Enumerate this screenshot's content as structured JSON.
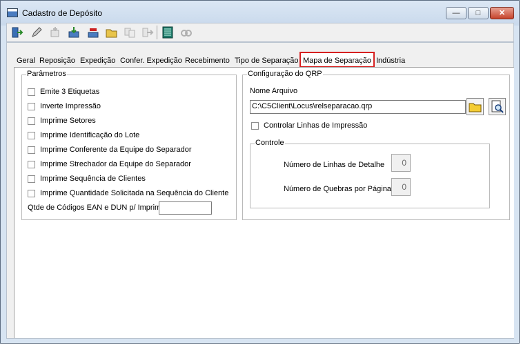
{
  "window": {
    "title": "Cadastro de Depósito"
  },
  "toolbar": {
    "icons": [
      "exit-icon",
      "edit-icon",
      "new-icon",
      "save-icon",
      "delete-icon",
      "open-icon",
      "copy-icon",
      "export-icon",
      "report-icon",
      "search-icon"
    ]
  },
  "tabs": [
    {
      "label": "Geral"
    },
    {
      "label": "Reposição"
    },
    {
      "label": "Expedição"
    },
    {
      "label": "Confer. Expedição"
    },
    {
      "label": "Recebimento"
    },
    {
      "label": "Tipo de Separação"
    },
    {
      "label": "Mapa de Separação",
      "active": true
    },
    {
      "label": "Indústria"
    }
  ],
  "parametros": {
    "title": "Parâmetros",
    "options": [
      {
        "label": "Emite 3 Etiquetas",
        "checked": false
      },
      {
        "label": "Inverte Impressão",
        "checked": false
      },
      {
        "label": "Imprime Setores",
        "checked": false
      },
      {
        "label": "Imprime Identificação do Lote",
        "checked": false
      },
      {
        "label": "Imprime Conferente da Equipe do Separador",
        "checked": false
      },
      {
        "label": "Imprime Strechador da Equipe do Separador",
        "checked": false
      },
      {
        "label": "Imprime Sequência de Clientes",
        "checked": false
      },
      {
        "label": "Imprime Quantidade Solicitada na Sequência do Cliente",
        "checked": false
      }
    ],
    "qtde_label": "Qtde de Códigos EAN e DUN p/ Imprimir",
    "qtde_value": ""
  },
  "qrp": {
    "title": "Configuração do QRP",
    "nome_arquivo_label": "Nome Arquivo",
    "nome_arquivo_value": "C:\\C5Client\\Locus\\relseparacao.qrp",
    "controlar_label": "Controlar Linhas de Impressão",
    "controlar_checked": false,
    "controle": {
      "title": "Controle",
      "linhas_label": "Número de Linhas de Detalhe",
      "linhas_value": "0",
      "quebras_label": "Número de Quebras por Página",
      "quebras_value": "0"
    }
  },
  "colors": {
    "active_tab_border": "#d62020",
    "window_frame": "#d7e4f2"
  }
}
